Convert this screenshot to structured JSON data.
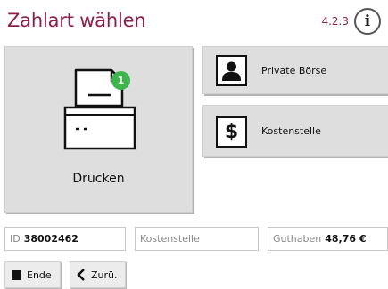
{
  "header": {
    "title": "Zahlart wählen",
    "version": "4.2.3",
    "info_glyph": "i"
  },
  "tiles": {
    "print": {
      "label": "Drucken",
      "badge": "1",
      "icon": "printer-icon"
    },
    "private": {
      "label": "Private Börse",
      "icon": "person-icon"
    },
    "cost": {
      "label": "Kostenstelle",
      "icon": "dollar-icon",
      "glyph": "$"
    }
  },
  "fields": {
    "id": {
      "label": "ID",
      "value": "38002462"
    },
    "cost_center": {
      "placeholder": "Kostenstelle"
    },
    "credit": {
      "label": "Guthaben",
      "value": "48,76 €"
    }
  },
  "footer": {
    "end_label": "Ende",
    "back_label": "Zurü."
  },
  "colors": {
    "accent": "#8e1e4b",
    "badge": "#3cb54a",
    "tile": "#dedede"
  }
}
